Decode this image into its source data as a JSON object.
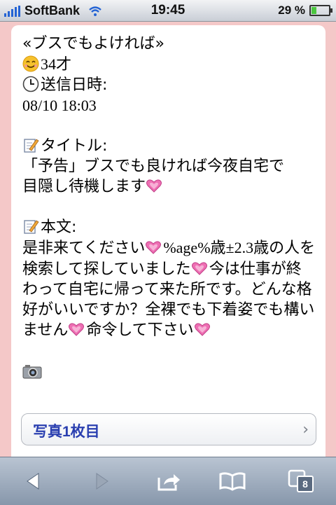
{
  "status_bar": {
    "carrier": "SoftBank",
    "time": "19:45",
    "battery_percent": "29 %",
    "battery_level": 0.29
  },
  "message": {
    "name": "«ブスでもよければ»",
    "age": "34才",
    "sent_label": "送信日時:",
    "sent_time": "08/10 18:03",
    "title_label": "タイトル:",
    "title_part1": "「予告」ブスでも良ければ今夜自宅で",
    "title_part2": "目隠し待機します",
    "body_label": "本文:",
    "body_part1": "是非来てください",
    "body_part2": "%age%歳±2.3歳の人を検索して探していました",
    "body_part3": "今は仕事が終わって自宅に帰って来た所です。どんな格好がいいですか？全裸でも下着姿でも構いません",
    "body_part4": "命令して下さい"
  },
  "photo_button": {
    "label": "写真1枚目"
  },
  "toolbar": {
    "tab_count": "8"
  },
  "icons": [
    "signal-icon",
    "wifi-icon",
    "battery-icon",
    "smiley-icon",
    "clock-icon",
    "memo-icon",
    "heart-icon",
    "camera-icon",
    "chevron-right-icon",
    "back-icon",
    "forward-icon",
    "share-icon",
    "bookmarks-icon",
    "tabs-icon"
  ]
}
